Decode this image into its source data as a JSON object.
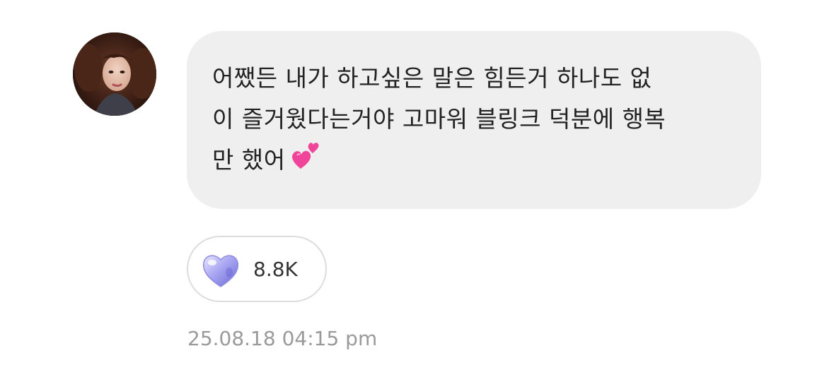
{
  "message": {
    "lines": [
      "어쨌든 내가 하고싶은 말은 힘든거 하나도 없",
      "이 즐거웠다는거야 고마워 블링크 덕분에 행복",
      "만 했어"
    ],
    "emoji": "two-hearts-emoji"
  },
  "reaction": {
    "icon": "glass-heart-icon",
    "count": "8.8K"
  },
  "timestamp": "25.08.18 04:15 pm",
  "colors": {
    "bubble": "#efefef",
    "text": "#222222",
    "timestamp": "#9a9a9a",
    "reaction_border": "#dcdcdc"
  }
}
